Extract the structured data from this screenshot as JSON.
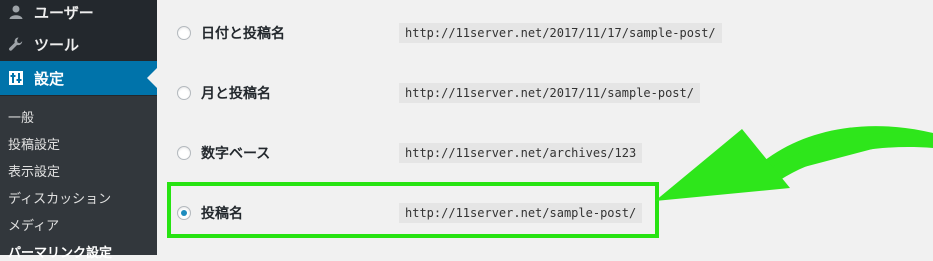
{
  "sidebar": {
    "menu": [
      {
        "label": "ユーザー",
        "icon": "user-icon"
      },
      {
        "label": "ツール",
        "icon": "wrench-icon"
      },
      {
        "label": "設定",
        "icon": "settings-icon"
      }
    ],
    "submenu": [
      "一般",
      "投稿設定",
      "表示設定",
      "ディスカッション",
      "メディア",
      "パーマリンク設定"
    ]
  },
  "options": [
    {
      "label": "日付と投稿名",
      "example": "http://11server.net/2017/11/17/sample-post/",
      "checked": false
    },
    {
      "label": "月と投稿名",
      "example": "http://11server.net/2017/11/sample-post/",
      "checked": false
    },
    {
      "label": "数字ベース",
      "example": "http://11server.net/archives/123",
      "checked": false
    },
    {
      "label": "投稿名",
      "example": "http://11server.net/sample-post/",
      "checked": true
    }
  ],
  "colors": {
    "accent": "#0073aa",
    "highlight_box": "#27e312",
    "arrow": "#2ee61b",
    "radio_checked": "#1e8cbe"
  }
}
